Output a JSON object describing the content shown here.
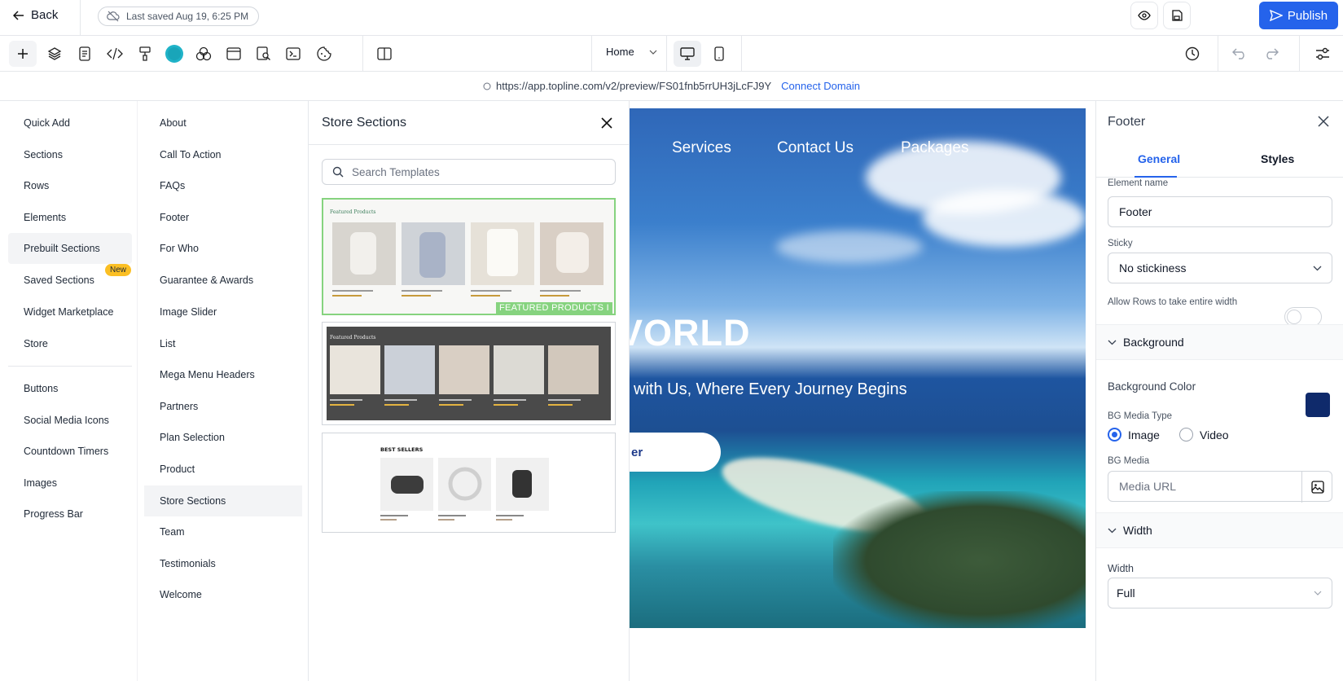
{
  "topbar": {
    "back_label": "Back",
    "saved_label": "Last saved Aug 19, 6:25 PM",
    "publish_label": "Publish"
  },
  "toolbar": {
    "page_select": "Home",
    "icons": [
      "add-icon",
      "layers-icon",
      "pages-icon",
      "code-icon",
      "paint-roller-icon",
      "color-swatch-icon",
      "shapes-icon",
      "layout-icon",
      "seo-icon",
      "terminal-icon",
      "cookie-icon",
      "split-view-icon"
    ]
  },
  "urlbar": {
    "url": "https://app.topline.com/v2/preview/FS01fnb5rrUH3jLcFJ9Y",
    "connect_label": "Connect Domain"
  },
  "add_menu": {
    "items": [
      "Quick Add",
      "Sections",
      "Rows",
      "Elements",
      "Prebuilt Sections",
      "Saved Sections",
      "Widget Marketplace",
      "Store"
    ],
    "items2": [
      "Buttons",
      "Social Media Icons",
      "Countdown Timers",
      "Images",
      "Progress Bar"
    ],
    "active": "Prebuilt Sections",
    "new_badge": "New"
  },
  "section_categories": {
    "items": [
      "About",
      "Call To Action",
      "FAQs",
      "Footer",
      "For Who",
      "Guarantee & Awards",
      "Image Slider",
      "List",
      "Mega Menu Headers",
      "Partners",
      "Plan Selection",
      "Product",
      "Store Sections",
      "Team",
      "Testimonials",
      "Welcome"
    ],
    "active": "Store Sections"
  },
  "templates_panel": {
    "title": "Store Sections",
    "search_placeholder": "Search Templates",
    "selected_tag": "FEATURED PRODUCTS I",
    "tpl1_heading": "Featured Products",
    "tpl2_heading": "Featured Products",
    "tpl3_heading": "BEST SELLERS"
  },
  "canvas": {
    "nav": [
      "Services",
      "Contact Us",
      "Packages"
    ],
    "hero_title": "VORLD",
    "hero_subtitle": "with Us, Where Every Journey Begins",
    "hero_button": "er"
  },
  "properties": {
    "title": "Footer",
    "tabs": [
      "General",
      "Styles"
    ],
    "element_name_label": "Element name",
    "element_name_value": "Footer",
    "sticky_label": "Sticky",
    "sticky_value": "No stickiness",
    "allow_rows_label": "Allow Rows to take entire width",
    "background_section": "Background",
    "bg_color_label": "Background Color",
    "bg_color": "#0f2a6b",
    "bg_media_type_label": "BG Media Type",
    "media_options": [
      "Image",
      "Video"
    ],
    "media_selected": "Image",
    "bg_media_label": "BG Media",
    "media_placeholder": "Media URL",
    "width_section": "Width",
    "width_label": "Width",
    "width_value": "Full"
  },
  "colors": {
    "accent": "#2563eb",
    "selected_border": "#86d37f",
    "badge": "#fbbf24"
  }
}
